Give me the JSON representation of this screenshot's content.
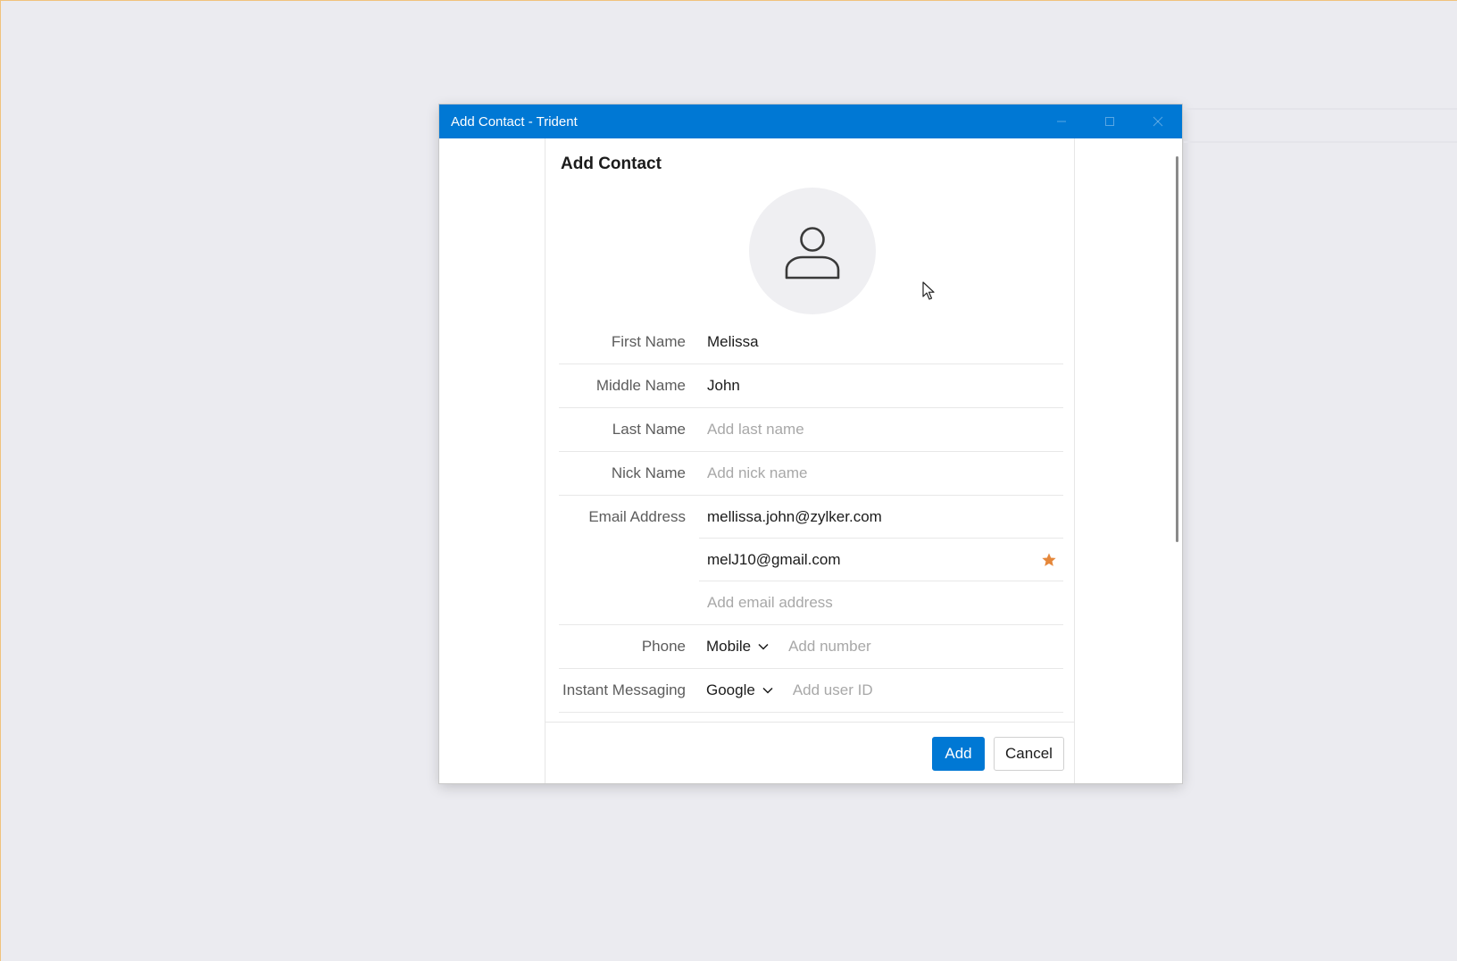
{
  "window": {
    "title": "Add Contact - Trident"
  },
  "panel": {
    "title": "Add Contact"
  },
  "form": {
    "first_name": {
      "label": "First Name",
      "value": "Melissa",
      "placeholder": ""
    },
    "middle_name": {
      "label": "Middle Name",
      "value": "John",
      "placeholder": ""
    },
    "last_name": {
      "label": "Last Name",
      "value": "",
      "placeholder": "Add last name"
    },
    "nick_name": {
      "label": "Nick Name",
      "value": "",
      "placeholder": "Add nick name"
    },
    "email": {
      "label": "Email Address",
      "entries": [
        {
          "value": "mellissa.john@zylker.com",
          "starred": false
        },
        {
          "value": "melJ10@gmail.com",
          "starred": true
        }
      ],
      "add_placeholder": "Add email address"
    },
    "phone": {
      "label": "Phone",
      "type": "Mobile",
      "placeholder": "Add number"
    },
    "im": {
      "label": "Instant Messaging",
      "type": "Google",
      "placeholder": "Add user ID"
    }
  },
  "footer": {
    "add_label": "Add",
    "cancel_label": "Cancel"
  },
  "icons": {
    "avatar": "person-icon",
    "star": "star-icon",
    "chevron": "chevron-down-icon",
    "minimize": "minimize-icon",
    "maximize": "maximize-icon",
    "close": "close-icon"
  },
  "colors": {
    "accent": "#0078d4",
    "star": "#e5873a",
    "label": "#5c5c5c",
    "placeholder": "#a8a8a8"
  }
}
